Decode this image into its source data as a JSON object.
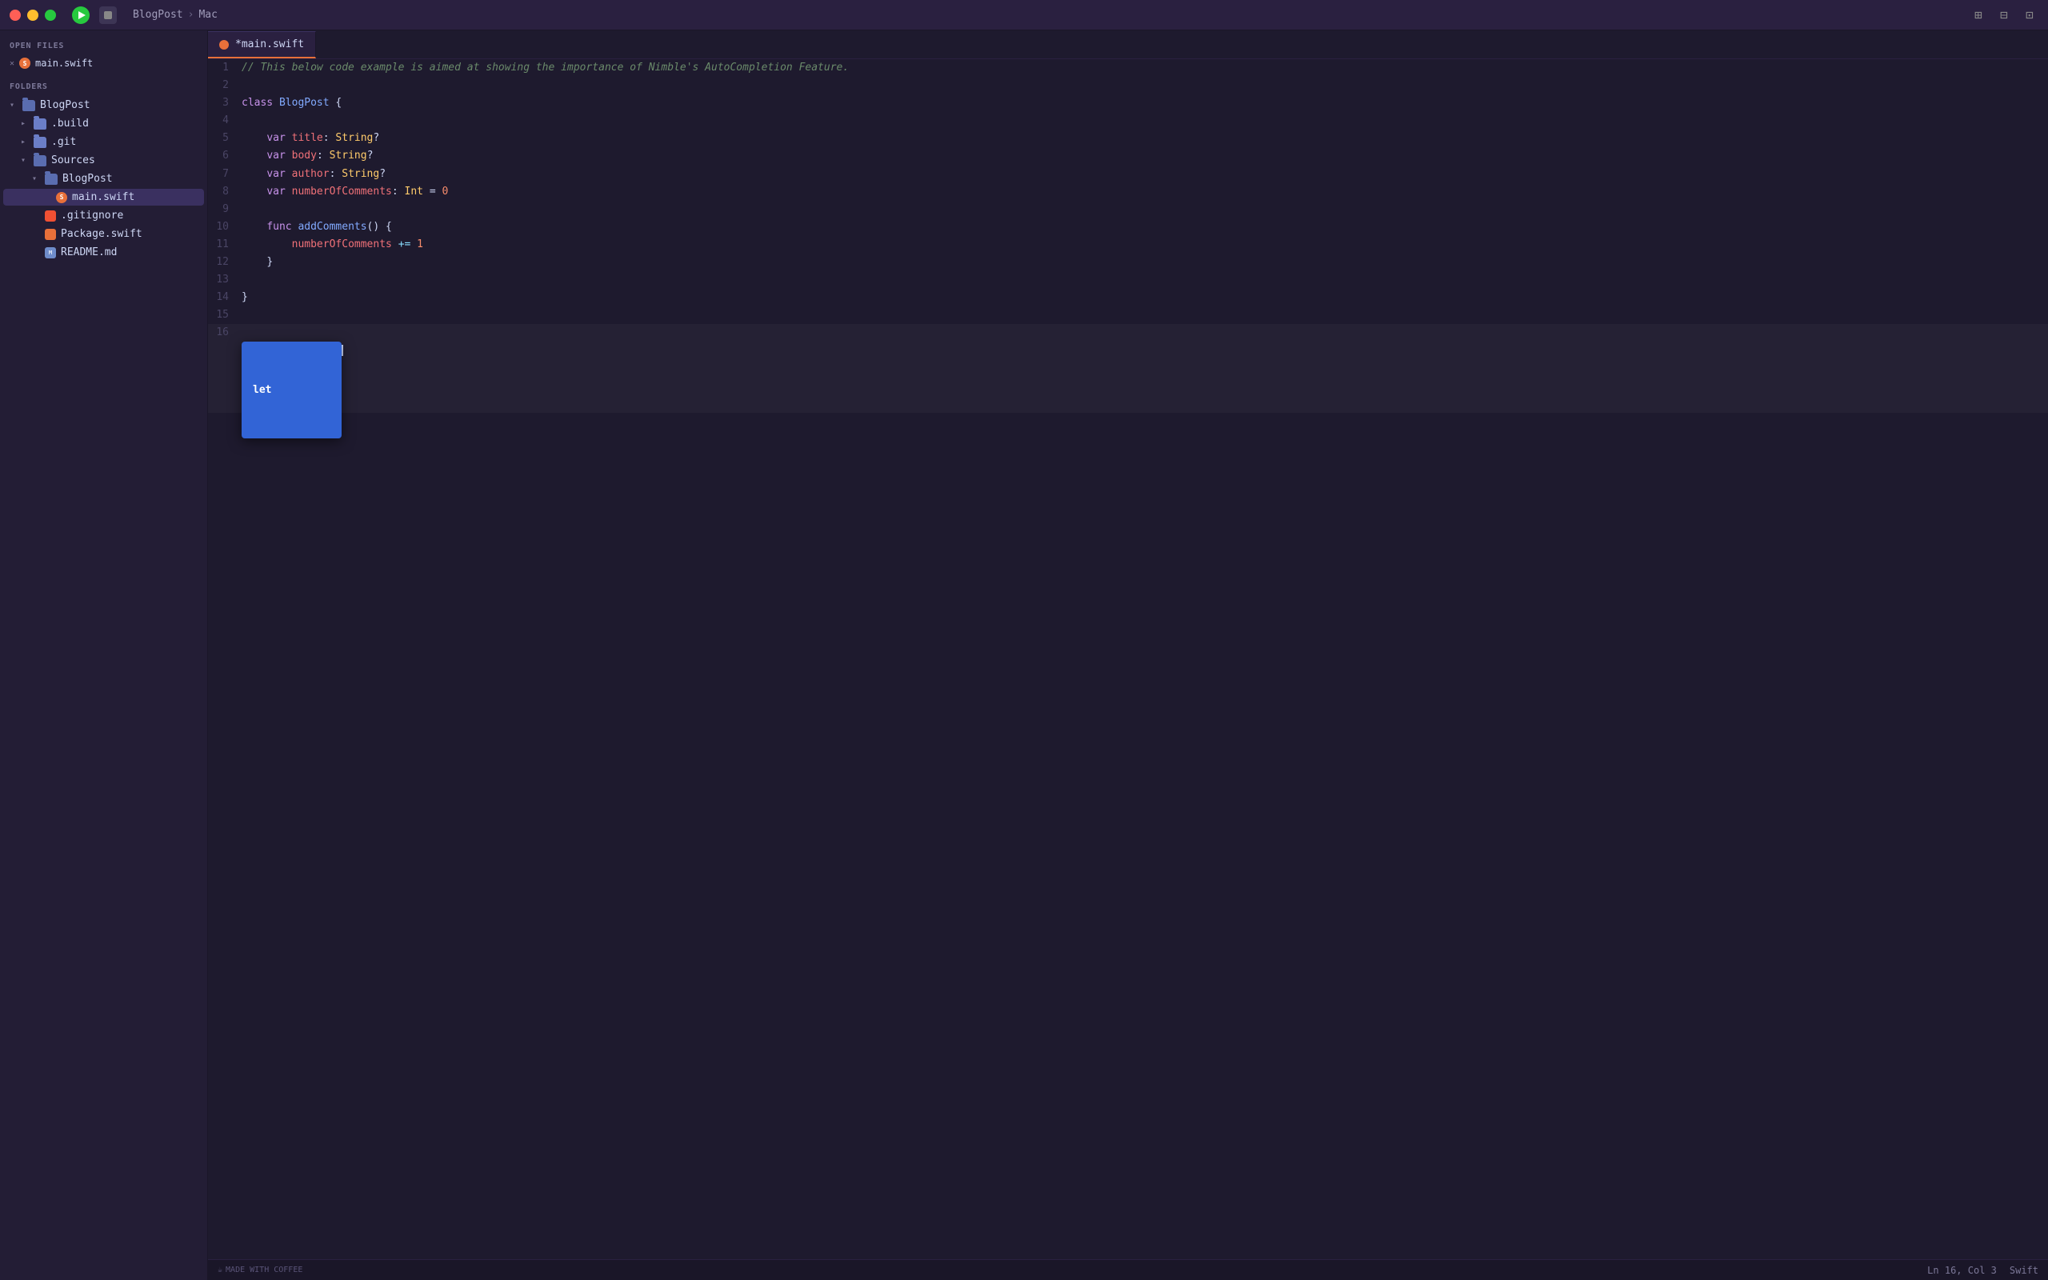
{
  "titleBar": {
    "breadcrumb": [
      "BlogPost",
      "Mac"
    ],
    "breadcrumbSep": "›",
    "windowControls": [
      "close",
      "minimize",
      "maximize"
    ]
  },
  "sidebar": {
    "openFilesLabel": "OPEN FILES",
    "openFiles": [
      {
        "name": "main.swift",
        "modified": true
      }
    ],
    "foldersLabel": "FOLDERS",
    "tree": [
      {
        "id": "blogpost-root",
        "name": "BlogPost",
        "type": "folder",
        "depth": 0,
        "expanded": true
      },
      {
        "id": "build",
        "name": ".build",
        "type": "folder",
        "depth": 1,
        "expanded": false
      },
      {
        "id": "git",
        "name": ".git",
        "type": "folder",
        "depth": 1,
        "expanded": false
      },
      {
        "id": "sources",
        "name": "Sources",
        "type": "folder",
        "depth": 1,
        "expanded": true
      },
      {
        "id": "blogpost-sub",
        "name": "BlogPost",
        "type": "folder",
        "depth": 2,
        "expanded": true
      },
      {
        "id": "main-swift",
        "name": "main.swift",
        "type": "swift",
        "depth": 3,
        "active": true
      },
      {
        "id": "gitignore",
        "name": ".gitignore",
        "type": "git",
        "depth": 2
      },
      {
        "id": "package-swift",
        "name": "Package.swift",
        "type": "package",
        "depth": 2
      },
      {
        "id": "readme",
        "name": "README.md",
        "type": "md",
        "depth": 2
      }
    ]
  },
  "tab": {
    "label": "*main.swift",
    "modified": true
  },
  "code": {
    "lines": [
      {
        "num": 1,
        "content": "// This below code example is aimed at showing the importance of Nimble's AutoCompletion Feature."
      },
      {
        "num": 2,
        "content": ""
      },
      {
        "num": 3,
        "content": "class BlogPost {"
      },
      {
        "num": 4,
        "content": ""
      },
      {
        "num": 5,
        "content": "    var title: String?"
      },
      {
        "num": 6,
        "content": "    var body: String?"
      },
      {
        "num": 7,
        "content": "    var author: String?"
      },
      {
        "num": 8,
        "content": "    var numberOfComments: Int = 0"
      },
      {
        "num": 9,
        "content": ""
      },
      {
        "num": 10,
        "content": "    func addComments() {"
      },
      {
        "num": 11,
        "content": "        numberOfComments += 1"
      },
      {
        "num": 12,
        "content": "    }"
      },
      {
        "num": 13,
        "content": ""
      },
      {
        "num": 14,
        "content": "}"
      },
      {
        "num": 15,
        "content": ""
      },
      {
        "num": 16,
        "content": "le"
      }
    ]
  },
  "autocomplete": {
    "items": [
      "let"
    ],
    "selected": 0
  },
  "statusBar": {
    "madeWith": "MADE WITH COFFEE",
    "position": "Ln 16, Col 3",
    "language": "Swift"
  }
}
